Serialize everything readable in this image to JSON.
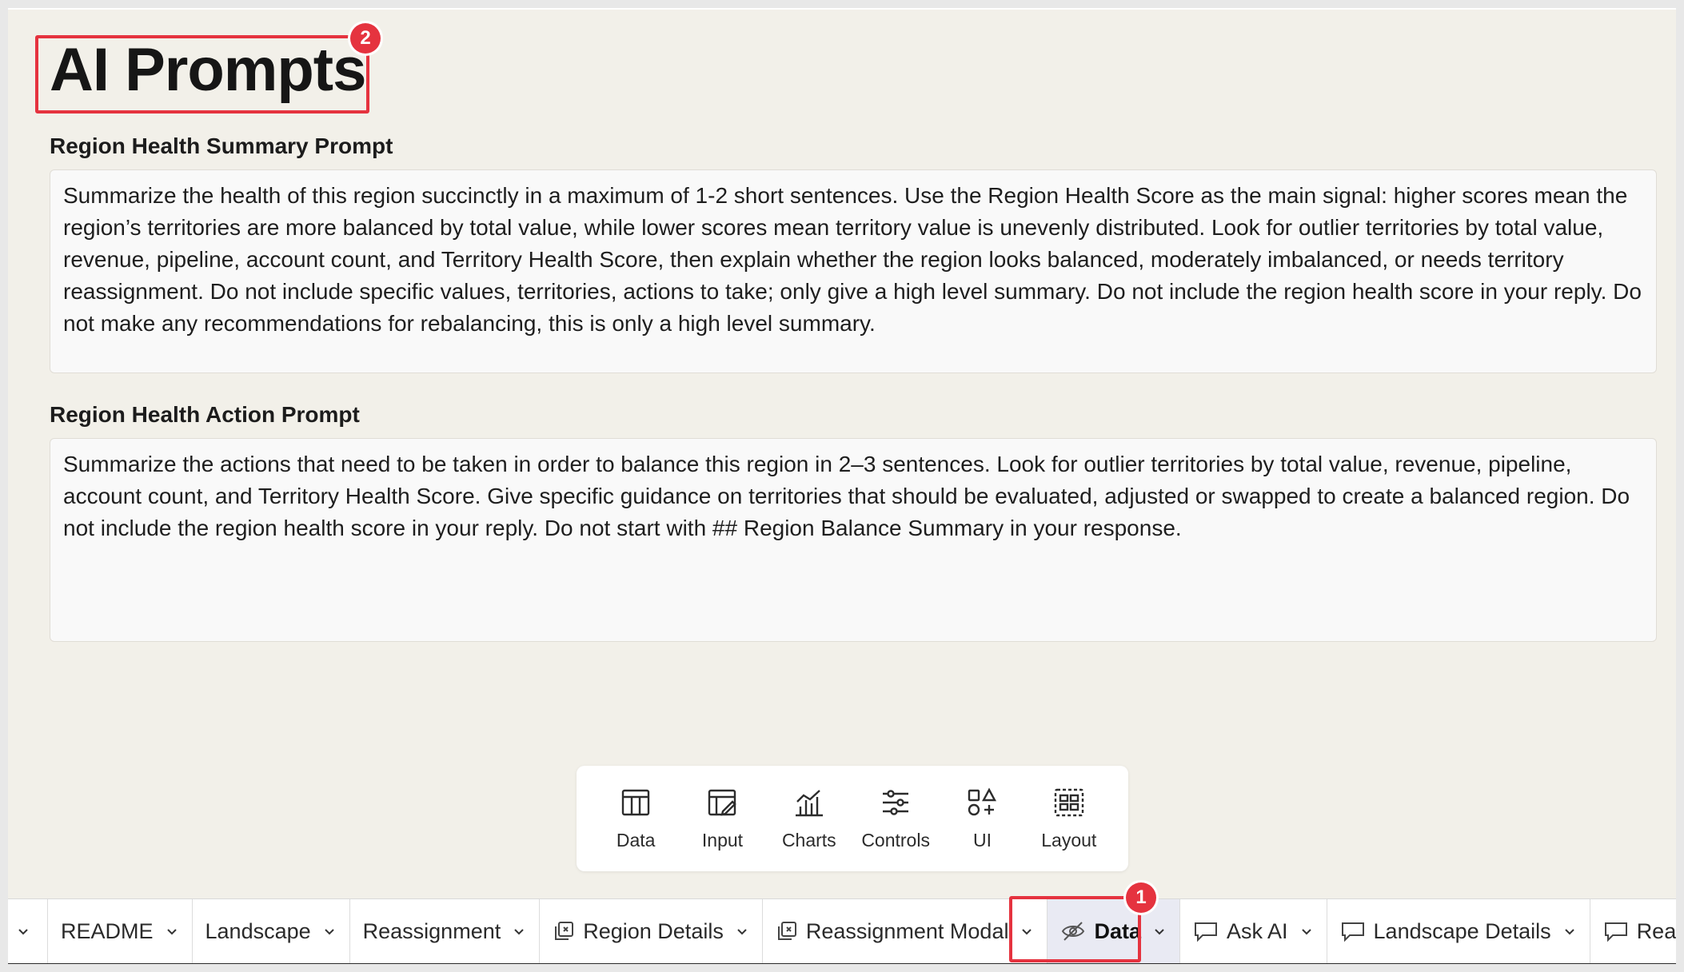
{
  "page": {
    "title": "AI Prompts",
    "title_badge": "2"
  },
  "fields": [
    {
      "label": "Region Health Summary Prompt",
      "value": "Summarize the health of this region succinctly in a maximum of 1-2 short sentences. Use the Region Health Score as the main signal: higher scores mean the region’s territories are more balanced by total value, while lower scores mean territory value is unevenly distributed. Look for outlier territories by total value, revenue, pipeline, account count, and Territory Health Score, then explain whether the region looks balanced, moderately imbalanced, or needs territory reassignment. Do not include specific values, territories, actions to take; only give a high level summary. Do not include the region health score in your reply. Do not make any recommendations for rebalancing, this is only a high level summary."
    },
    {
      "label": "Region Health Action Prompt",
      "value": "Summarize the actions that need to be taken in order to balance this region in 2–3 sentences. Look for outlier territories by total value, revenue, pipeline, account count, and Territory Health Score. Give specific guidance on territories that should be evaluated, adjusted or swapped to create a balanced region. Do not include the region health score in your reply. Do not start with ## Region Balance Summary in your response."
    }
  ],
  "toolbar": [
    {
      "label": "Data",
      "icon": "table-icon"
    },
    {
      "label": "Input",
      "icon": "input-table-icon"
    },
    {
      "label": "Charts",
      "icon": "chart-icon"
    },
    {
      "label": "Controls",
      "icon": "sliders-icon"
    },
    {
      "label": "UI",
      "icon": "shapes-icon"
    },
    {
      "label": "Layout",
      "icon": "layout-icon"
    }
  ],
  "tabs": [
    {
      "label": "README",
      "icon": null
    },
    {
      "label": "Landscape",
      "icon": null
    },
    {
      "label": "Reassignment",
      "icon": null
    },
    {
      "label": "Region Details",
      "icon": "modal-icon"
    },
    {
      "label": "Reassignment Modal",
      "icon": "modal-icon"
    },
    {
      "label": "Data",
      "icon": "eye-off-icon",
      "active": true,
      "badge": "1"
    },
    {
      "label": "Ask AI",
      "icon": "popover-icon"
    },
    {
      "label": "Landscape Details",
      "icon": "popover-icon"
    },
    {
      "label": "Reassignm",
      "icon": "popover-icon"
    }
  ],
  "colors": {
    "canvas": "#f2f0e9",
    "callout": "#e5333f",
    "active_tab": "#e9eaf3"
  }
}
